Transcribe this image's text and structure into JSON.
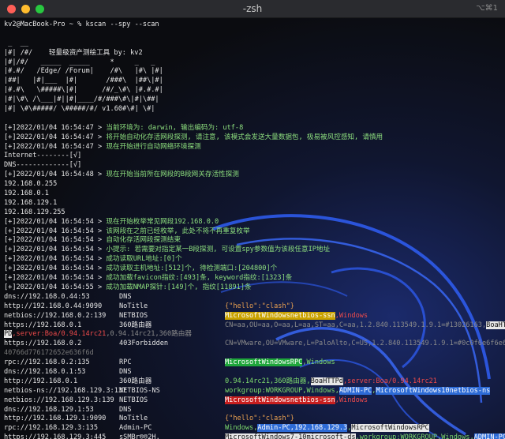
{
  "window": {
    "title": "-zsh",
    "shortcut": "⌥⌘1"
  },
  "prompt": "kv2@MacBook-Pro ~ % kscan --spy --scan",
  "banner": [
    " _  __",
    "|#| /#/    轻量级资产测绘工具 by: kv2",
    "|#|/#/   _____  _____     *     _   _",
    "|#.#/   /Edge/ /Forum|    /#\\   |#\\ |#|",
    "|##|   |#|___  |#|       /###\\  |##\\|#|",
    "|#.#\\   \\#####\\|#|      /#/_\\#\\ |#.#.#|",
    "|#|\\#\\ /\\___|#||#|____/#/###\\#\\|#|\\##|",
    "|#| \\#\\#####/ \\#####/#/ v1.60#\\#| \\#|"
  ],
  "logs": [
    {
      "prefix": "[+]2022/01/04 16:54:47 >",
      "msg": "当前环境为: darwin, 输出编码为: utf-8"
    },
    {
      "prefix": "[+]2022/01/04 16:54:47 >",
      "msg": "将开始自动化存活网段探测, 请注意, 该模式会发送大量数据包, 极易被风控感知, 请慎用"
    },
    {
      "prefix": "[+]2022/01/04 16:54:47 >",
      "msg": "现在开始进行自动网络环境探测"
    },
    {
      "prefix": "Internet--------[√]",
      "msg": ""
    },
    {
      "prefix": "DNS-------------[√]",
      "msg": ""
    },
    {
      "prefix": "[+]2022/01/04 16:54:48 >",
      "msg": "现在开始当前所在网段的B段网关存活性探测"
    },
    {
      "prefix": "192.168.0.255",
      "msg": ""
    },
    {
      "prefix": "192.168.0.1",
      "msg": ""
    },
    {
      "prefix": "192.168.129.1",
      "msg": ""
    },
    {
      "prefix": "192.168.129.255",
      "msg": ""
    },
    {
      "prefix": "[+]2022/01/04 16:54:54 >",
      "msg": "现在开始枚举常见网段192.168.0.0"
    },
    {
      "prefix": "[+]2022/01/04 16:54:54 >",
      "msg": "该网段在之前已经枚举, 此处不将不再重复枚举"
    },
    {
      "prefix": "[+]2022/01/04 16:54:54 >",
      "msg": "自动化存活网段探测结束"
    },
    {
      "prefix": "[+]2022/01/04 16:54:54 >",
      "msg": "小提示: 若需要对指定某一B段探测, 可设置spy参数值为该段任意IP地址"
    },
    {
      "prefix": "[+]2022/01/04 16:54:54 >",
      "msg": "成功读取URL地址:[0]个"
    },
    {
      "prefix": "[+]2022/01/04 16:54:54 >",
      "msg": "成功读取主机地址:[512]个, 待检测端口:[204800]个"
    },
    {
      "prefix": "[+]2022/01/04 16:54:54 >",
      "msg": "成功加载favicon指纹:[493]条, keyword指纹:[1323]条"
    },
    {
      "prefix": "[+]2022/01/04 16:54:55 >",
      "msg": "成功加载NMAP探针:[149]个, 指纹[11891]条"
    }
  ],
  "results": [
    {
      "c1": "dns://192.168.0.44:53",
      "c2": "DNS",
      "c3": []
    },
    {
      "c1": "http://192.168.0.44:9090",
      "c2": "NoTitle",
      "c3": [
        [
          "orange",
          "{\"hello\":\"clash\"}"
        ]
      ]
    },
    {
      "c1": "netbios://192.168.0.2:139",
      "c2": "NETBIOS",
      "c3": [
        [
          "hl-y",
          "MicrosoftWindowsnetbios-ssn"
        ],
        [
          "red",
          ","
        ],
        [
          "red",
          "Windows"
        ]
      ]
    },
    {
      "c1": "https://192.168.0.1",
      "c2": "360路由器",
      "c3": [
        [
          "gray2",
          "CN=aa,OU=aa,O=aa,L=aa,ST=aa,C=aa,1.2.840.113549.1.9.1=#13026163,"
        ],
        [
          "hl-w",
          "BoaHTT"
        ]
      ]
    },
    {
      "c1": "",
      "c2": "",
      "c3": [],
      "wrap": [
        [
          "hl-w",
          "PD"
        ],
        [
          "red",
          ",server:Boa/0.94.14rc21"
        ],
        [
          "gray2",
          ",0.94.14rc21,360路由器"
        ]
      ]
    },
    {
      "c1": "https://192.168.0.2",
      "c2": "403Forbidden",
      "c3": [
        [
          "gray2",
          "CN=VMware,OU=VMware,L=PaloAlto,C=US,1.2.840.113549.1.9.1=#0c0f6e6f6e65"
        ]
      ]
    },
    {
      "c1": "",
      "c2": "",
      "c3": [],
      "wrap": [
        [
          "dim",
          "40766d776172652e636f6d"
        ]
      ]
    },
    {
      "c1": "rpc://192.168.0.2:135",
      "c2": "RPC",
      "c3": [
        [
          "hl-g",
          "MicrosoftWindowsRPC"
        ],
        [
          "lgreen",
          ",Windows"
        ]
      ]
    },
    {
      "c1": "dns://192.168.0.1:53",
      "c2": "DNS",
      "c3": []
    },
    {
      "c1": "http://192.168.0.1",
      "c2": "360路由器",
      "c3": [
        [
          "lgreen",
          "0.94.14rc21,360路由器,"
        ],
        [
          "hl-w",
          "BoaHTTPd"
        ],
        [
          "red",
          ",server:Boa/0.94.14rc21"
        ]
      ]
    },
    {
      "c1": "netbios-ns://192.168.129.3:137",
      "c2": "NETBIOS-NS",
      "c3": [
        [
          "lgreen",
          "workgroup:WORKGROUP,Windows,"
        ],
        [
          "hl-b",
          "ADMIN-PC"
        ],
        [
          "lgreen",
          ","
        ],
        [
          "hl-b",
          "MicrosoftWindows10netbios-ns"
        ]
      ]
    },
    {
      "c1": "netbios://192.168.129.3:139",
      "c2": "NETBIOS",
      "c3": [
        [
          "hl-r",
          "MicrosoftWindowsnetbios-ssn"
        ],
        [
          "red",
          ",Windows"
        ]
      ]
    },
    {
      "c1": "dns://192.168.129.1:53",
      "c2": "DNS",
      "c3": []
    },
    {
      "c1": "http://192.168.129.1:9090",
      "c2": "NoTitle",
      "c3": [
        [
          "orange",
          "{\"hello\":\"clash\"}"
        ]
      ]
    },
    {
      "c1": "rpc://192.168.129.3:135",
      "c2": "Admin-PC",
      "c3": [
        [
          "lgreen",
          "Windows,"
        ],
        [
          "hl-b",
          "Admin-PC,192.168.129.3"
        ],
        [
          "lgreen",
          ","
        ],
        [
          "hl-w",
          "MicrosoftWindowsRPC"
        ]
      ]
    },
    {
      "c1": "https://192.168.129.3:445",
      "c2": "sSMBr®®2H.",
      "c3": [
        [
          "hl-w",
          "MicrosoftWindows7-10microsoft-ds"
        ],
        [
          "lgreen",
          ",workgroup:WORKGROUP,Windows,"
        ],
        [
          "hl-b",
          "ADMIN-PC"
        ]
      ]
    }
  ]
}
